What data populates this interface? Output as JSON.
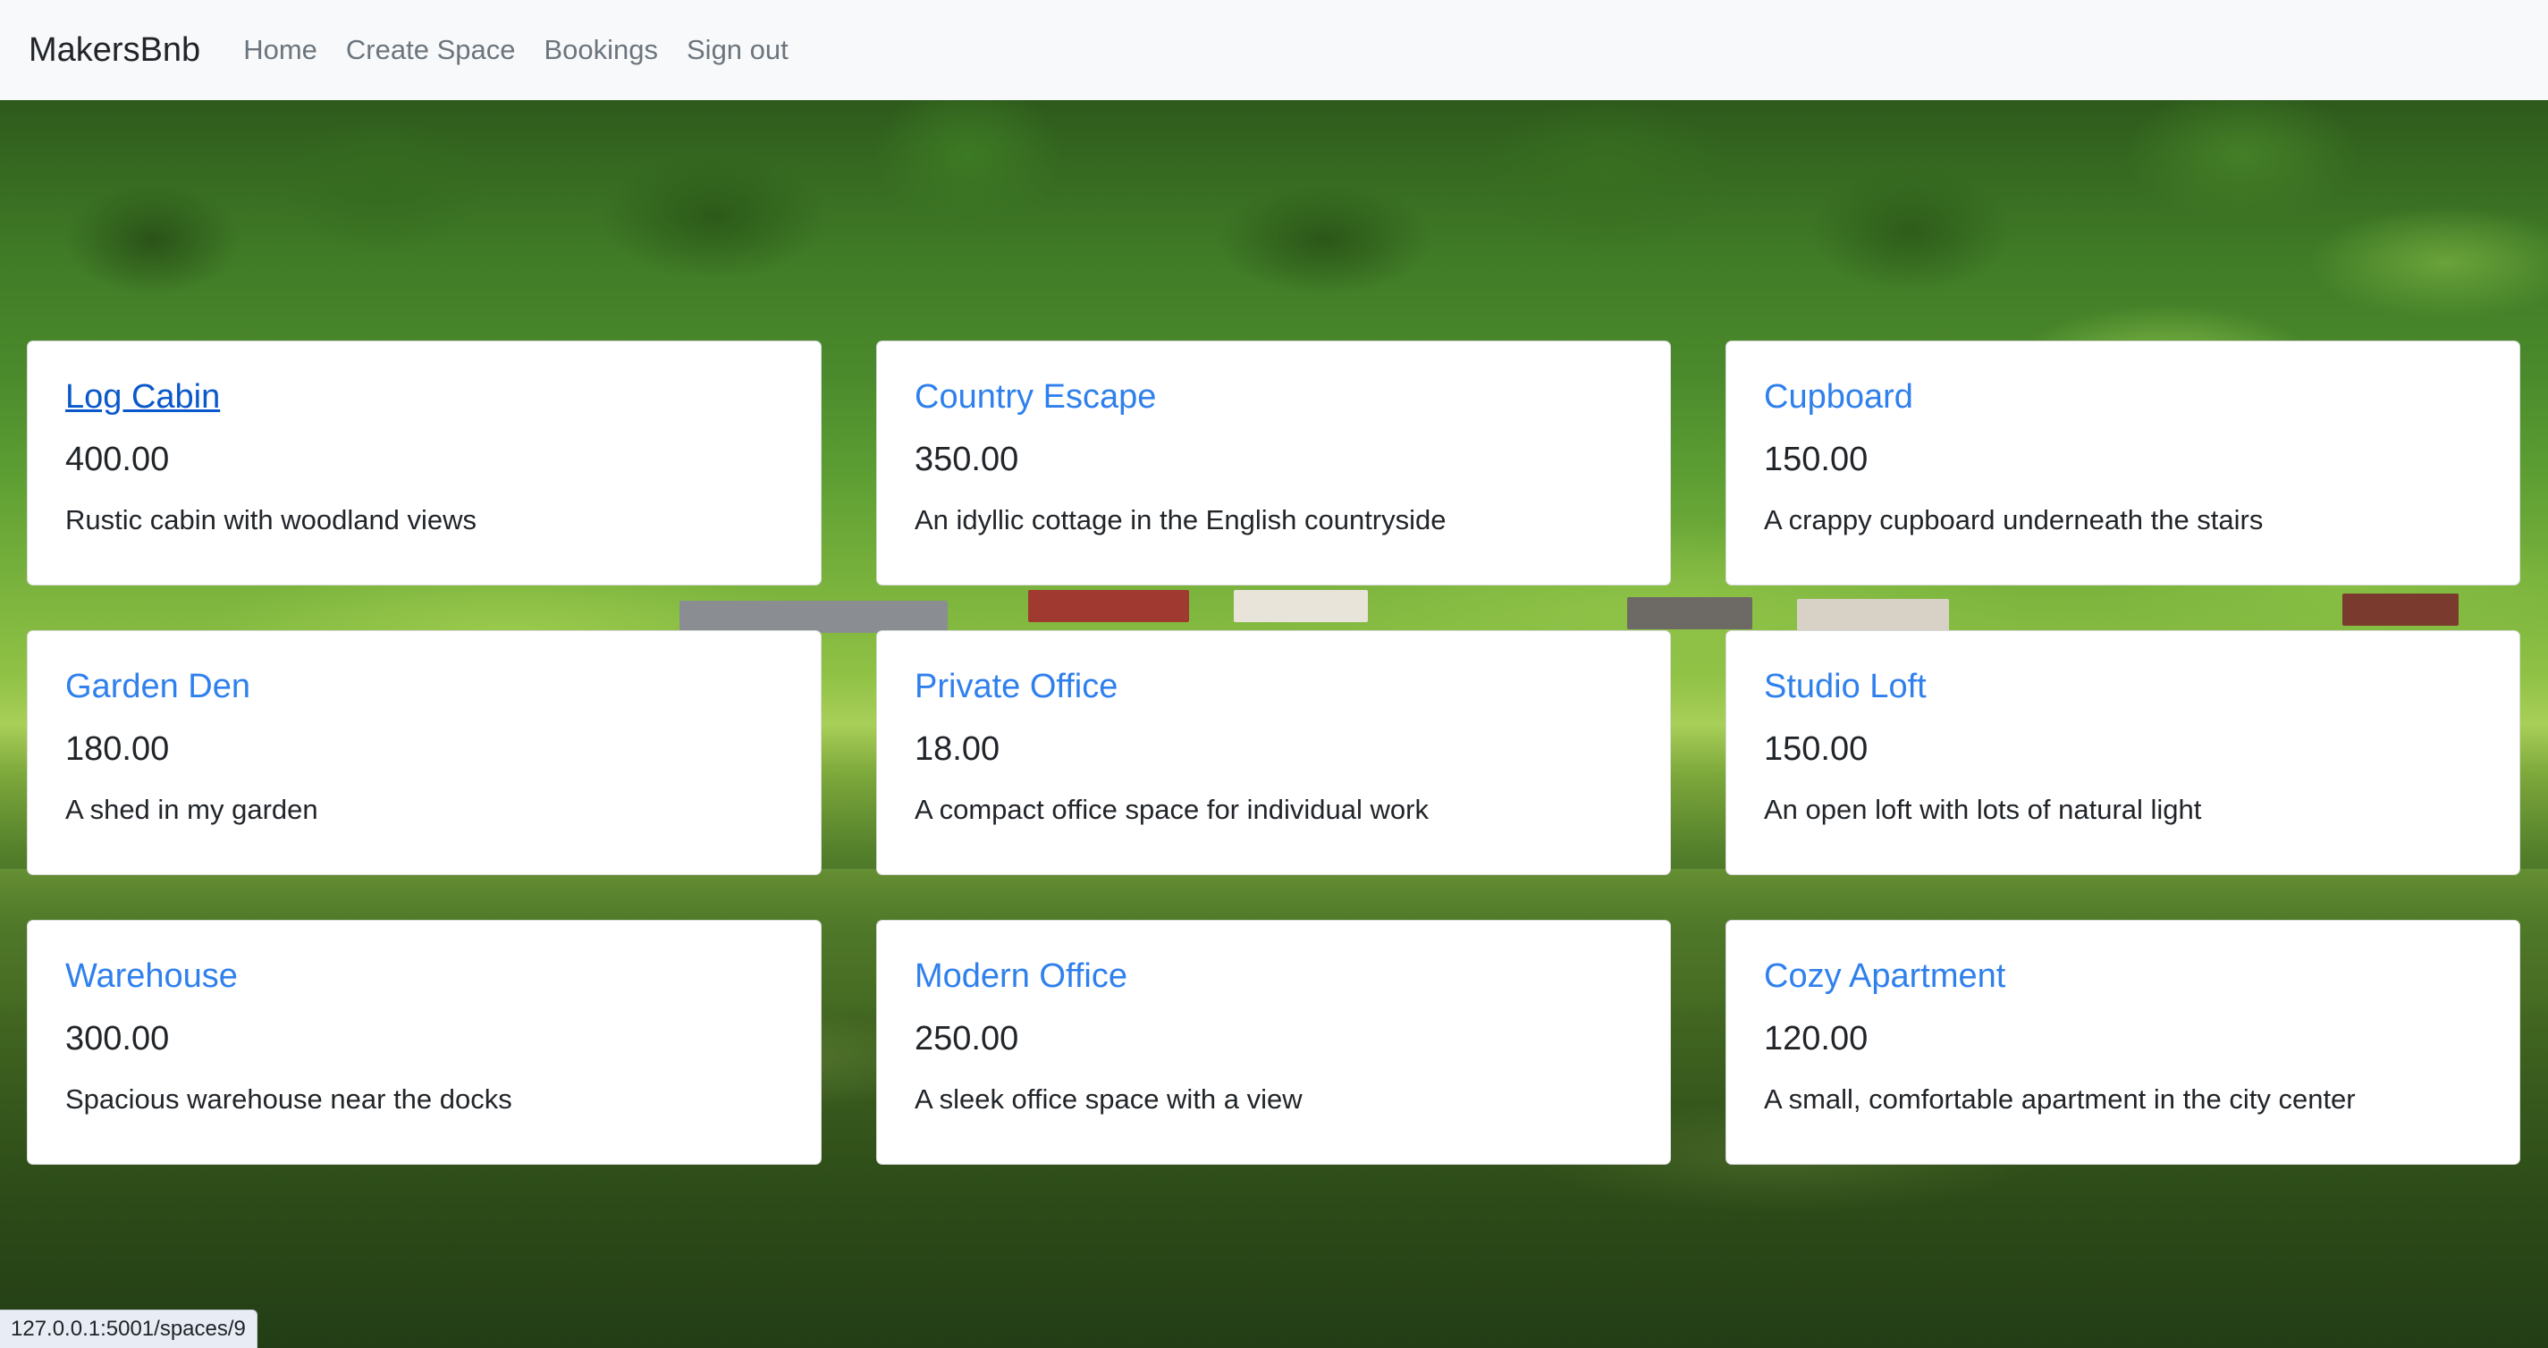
{
  "navbar": {
    "brand": "MakersBnb",
    "links": [
      {
        "label": "Home"
      },
      {
        "label": "Create Space"
      },
      {
        "label": "Bookings"
      },
      {
        "label": "Sign out"
      }
    ]
  },
  "spaces": [
    {
      "name": "Log Cabin",
      "price": "400.00",
      "description": "Rustic cabin with woodland views"
    },
    {
      "name": "Country Escape",
      "price": "350.00",
      "description": "An idyllic cottage in the English countryside"
    },
    {
      "name": "Cupboard",
      "price": "150.00",
      "description": "A crappy cupboard underneath the stairs"
    },
    {
      "name": "Garden Den",
      "price": "180.00",
      "description": "A shed in my garden"
    },
    {
      "name": "Private Office",
      "price": "18.00",
      "description": "A compact office space for individual work"
    },
    {
      "name": "Studio Loft",
      "price": "150.00",
      "description": "An open loft with lots of natural light"
    },
    {
      "name": "Warehouse",
      "price": "300.00",
      "description": "Spacious warehouse near the docks"
    },
    {
      "name": "Modern Office",
      "price": "250.00",
      "description": "A sleek office space with a view"
    },
    {
      "name": "Cozy Apartment",
      "price": "120.00",
      "description": "A small, comfortable apartment in the city center"
    }
  ],
  "status_bar": {
    "url": "127.0.0.1:5001/spaces/9"
  },
  "colors": {
    "link": "#2f80ed",
    "link_hover": "#0a58ca",
    "navbar_bg": "#f8f9fa"
  }
}
